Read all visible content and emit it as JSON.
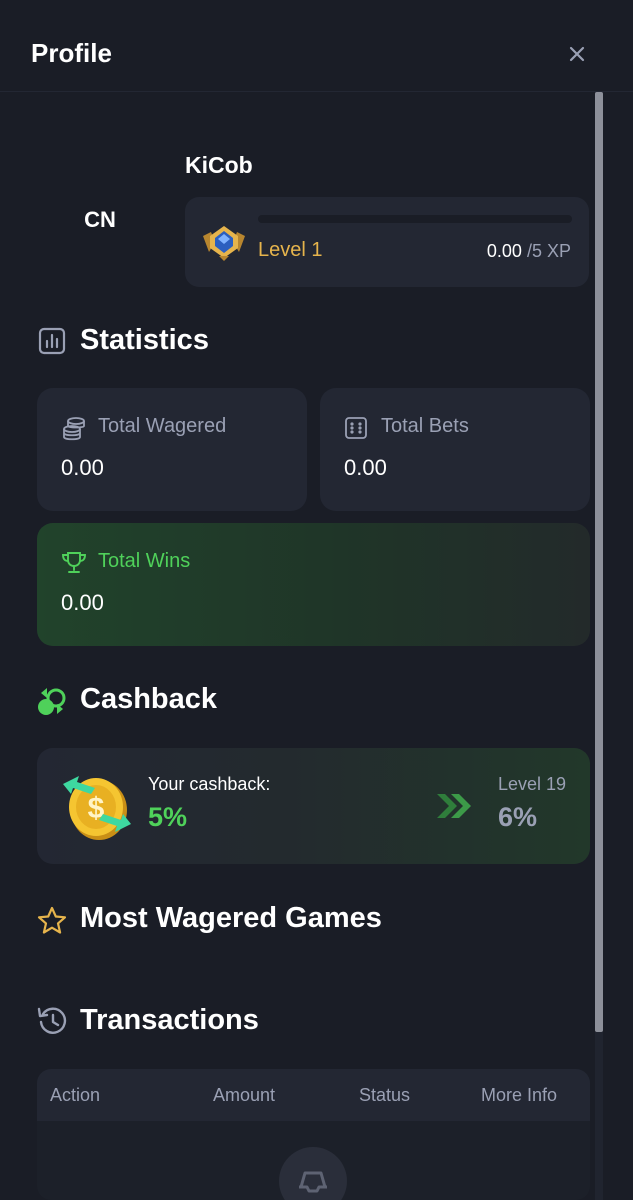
{
  "header": {
    "title": "Profile"
  },
  "profile": {
    "initials": "CN",
    "username": "KiCob",
    "level_label": "Level 1",
    "xp_current": "0.00",
    "xp_max": "/5 XP",
    "xp_progress": 0
  },
  "statistics": {
    "title": "Statistics",
    "total_wagered": {
      "label": "Total Wagered",
      "value": "0.00"
    },
    "total_bets": {
      "label": "Total Bets",
      "value": "0.00"
    },
    "total_wins": {
      "label": "Total Wins",
      "value": "0.00"
    }
  },
  "cashback": {
    "title": "Cashback",
    "your_label": "Your cashback:",
    "your_value": "5%",
    "next_level_label": "Level 19",
    "next_level_value": "6%"
  },
  "most_wagered": {
    "title": "Most Wagered Games"
  },
  "transactions": {
    "title": "Transactions",
    "columns": [
      "Action",
      "Amount",
      "Status",
      "More Info"
    ]
  },
  "colors": {
    "background": "#1a1d26",
    "card": "#232733",
    "accent_green": "#4fd15a",
    "accent_gold": "#e6b44c",
    "muted_text": "#9aa0b4"
  }
}
